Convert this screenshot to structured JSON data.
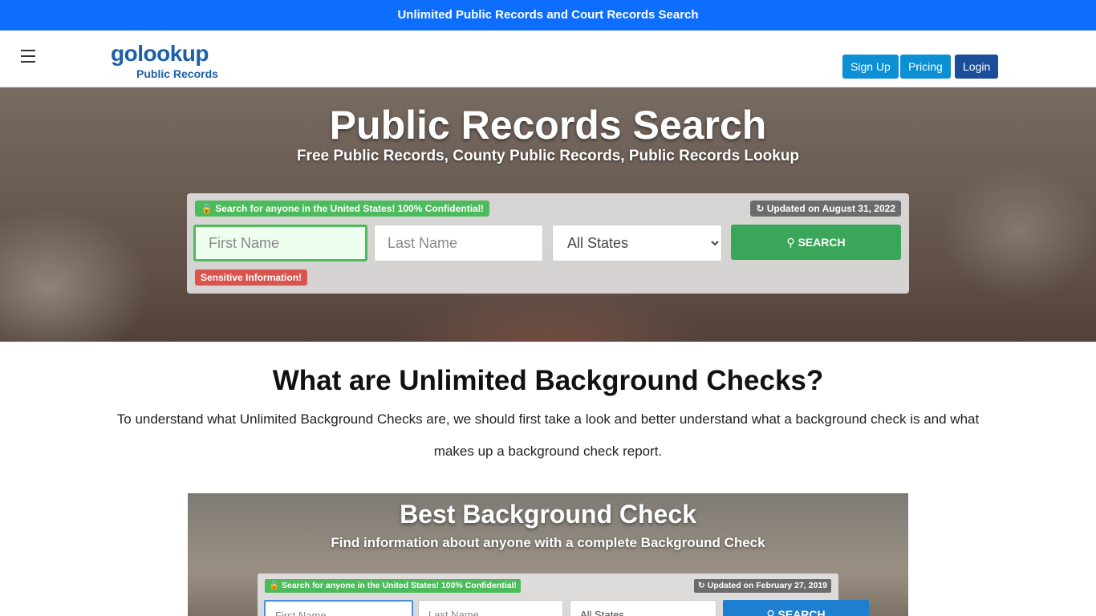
{
  "topbar": {
    "text": "Unlimited Public Records and Court Records Search"
  },
  "nav": {
    "logo_main": "golookup",
    "logo_sub": "Public Records",
    "signup": "Sign Up",
    "pricing": "Pricing",
    "login": "Login"
  },
  "hero": {
    "title": "Public Records Search",
    "subtitle": "Free Public Records, County Public Records, Public Records Lookup",
    "confidential_badge": "Search for anyone in the United States! 100% Confidential!",
    "updated_badge": "Updated on August 31, 2022",
    "first_name_placeholder": "First Name",
    "last_name_placeholder": "Last Name",
    "state_selected": "All States",
    "search_button": "SEARCH",
    "sensitive_badge": "Sensitive Information!"
  },
  "section": {
    "title": "What are Unlimited Background Checks?",
    "body": "To understand what Unlimited Background Checks are, we should first take a look and better understand what a background check is and what makes up a background check report."
  },
  "promo": {
    "title": "Best Background Check",
    "subtitle": "Find information about anyone with a complete Background Check",
    "confidential_badge": "Search for anyone in the United States! 100% Confidential!",
    "updated_badge": "Updated on February 27, 2019",
    "first_name": "First Name",
    "last_name": "Last Name",
    "state": "All States",
    "search_button": "SEARCH"
  },
  "colors": {
    "topbar": "#0d6efd",
    "brand": "#1b5fa8",
    "search_green": "#3aa65a",
    "sensitive_red": "#d9534f"
  }
}
